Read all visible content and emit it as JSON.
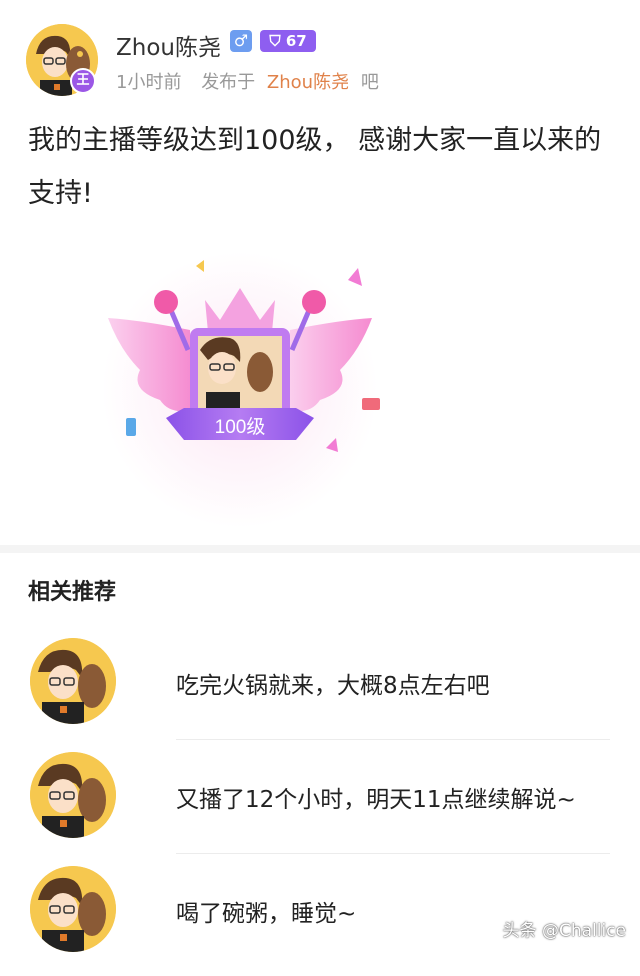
{
  "post": {
    "username": "Zhou陈尧",
    "gender_symbol": "♂",
    "level_badge": "67",
    "avatar_badge": "王",
    "time": "1小时前",
    "posted_in_label": "发布于",
    "forum_name": "Zhou陈尧",
    "forum_suffix": "吧",
    "content": "我的主播等级达到100级， 感谢大家一直以来的支持!",
    "level_graphic_label": "100级"
  },
  "related": {
    "title": "相关推荐",
    "items": [
      {
        "text": "吃完火锅就来，大概8点左右吧"
      },
      {
        "text": "又播了12个小时，明天11点继续解说~"
      },
      {
        "text": "喝了碗粥，睡觉~"
      }
    ]
  },
  "watermark": "头条 @Challice",
  "colors": {
    "avatar_bg": "#f6c84f",
    "level_badge": "#8e5ef0",
    "gender_badge": "#6d9df0",
    "forum_link": "#e0824a",
    "wing_pink": "#f27bd4",
    "ribbon_purple": "#9b57e6"
  }
}
